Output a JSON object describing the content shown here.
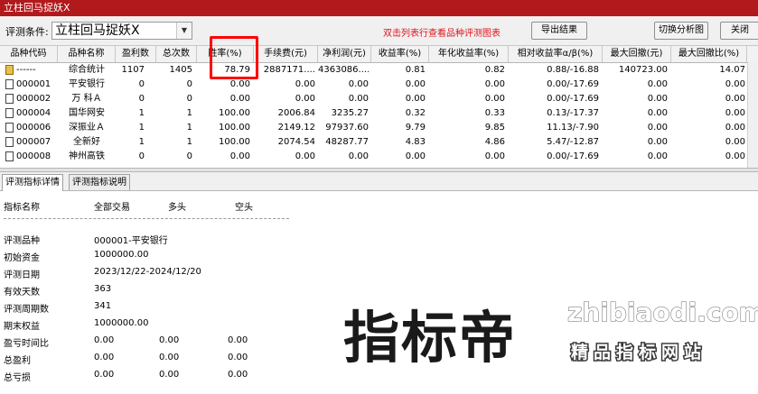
{
  "window": {
    "title": "立柱回马捉妖X"
  },
  "toolbar": {
    "condition_label": "评测条件:",
    "condition_value": "立柱回马捉妖X",
    "hint": "双击列表行查看品种评测图表",
    "export_label": "导出结果",
    "switch_label": "切换分析图",
    "close_label": "关闭"
  },
  "columns": [
    "品种代码",
    "品种名称",
    "盈利数",
    "总次数",
    "胜率(%)",
    "手续费(元)",
    "净利润(元)",
    "收益率(%)",
    "年化收益率(%)",
    "相对收益率α/β(%)",
    "最大回撤(元)",
    "最大回撤比(%)"
  ],
  "rows": [
    {
      "code": "------",
      "name": "综合统计",
      "profit_count": "1107",
      "total": "1405",
      "win_rate": "78.79",
      "fee": "2887171....",
      "net": "4363086....",
      "ret": "0.81",
      "annual": "0.82",
      "alpha": "0.88/-16.88",
      "maxdd": "140723.00",
      "maxdd_pct": "14.07"
    },
    {
      "code": "000001",
      "name": "平安银行",
      "profit_count": "0",
      "total": "0",
      "win_rate": "0.00",
      "fee": "0.00",
      "net": "0.00",
      "ret": "0.00",
      "annual": "0.00",
      "alpha": "0.00/-17.69",
      "maxdd": "0.00",
      "maxdd_pct": "0.00"
    },
    {
      "code": "000002",
      "name": "万 科Ａ",
      "profit_count": "0",
      "total": "0",
      "win_rate": "0.00",
      "fee": "0.00",
      "net": "0.00",
      "ret": "0.00",
      "annual": "0.00",
      "alpha": "0.00/-17.69",
      "maxdd": "0.00",
      "maxdd_pct": "0.00"
    },
    {
      "code": "000004",
      "name": "国华网安",
      "profit_count": "1",
      "total": "1",
      "win_rate": "100.00",
      "fee": "2006.84",
      "net": "3235.27",
      "ret": "0.32",
      "annual": "0.33",
      "alpha": "0.13/-17.37",
      "maxdd": "0.00",
      "maxdd_pct": "0.00"
    },
    {
      "code": "000006",
      "name": "深振业Ａ",
      "profit_count": "1",
      "total": "1",
      "win_rate": "100.00",
      "fee": "2149.12",
      "net": "97937.60",
      "ret": "9.79",
      "annual": "9.85",
      "alpha": "11.13/-7.90",
      "maxdd": "0.00",
      "maxdd_pct": "0.00"
    },
    {
      "code": "000007",
      "name": "全新好",
      "profit_count": "1",
      "total": "1",
      "win_rate": "100.00",
      "fee": "2074.54",
      "net": "48287.77",
      "ret": "4.83",
      "annual": "4.86",
      "alpha": "5.47/-12.87",
      "maxdd": "0.00",
      "maxdd_pct": "0.00"
    },
    {
      "code": "000008",
      "name": "神州高铁",
      "profit_count": "0",
      "total": "0",
      "win_rate": "0.00",
      "fee": "0.00",
      "net": "0.00",
      "ret": "0.00",
      "annual": "0.00",
      "alpha": "0.00/-17.69",
      "maxdd": "0.00",
      "maxdd_pct": "0.00"
    }
  ],
  "tabs": [
    "评测指标详情",
    "评测指标说明"
  ],
  "detail": {
    "headers": [
      "指标名称",
      "全部交易",
      "多头",
      "空头"
    ],
    "items": [
      {
        "label": "评测品种",
        "v1": "000001-平安银行"
      },
      {
        "label": "初始资金",
        "v1": "1000000.00"
      },
      {
        "label": "评测日期",
        "v1": "2023/12/22-2024/12/20"
      },
      {
        "label": "有效天数",
        "v1": "363"
      },
      {
        "label": "评测周期数",
        "v1": "341"
      },
      {
        "label": "期末权益",
        "v1": "1000000.00"
      },
      {
        "label": "盈亏时间比",
        "v1": "0.00",
        "v2": "0.00",
        "v3": "0.00"
      },
      {
        "label": "总盈利",
        "v1": "0.00",
        "v2": "0.00",
        "v3": "0.00"
      },
      {
        "label": "总亏损",
        "v1": "0.00",
        "v2": "0.00",
        "v3": "0.00"
      }
    ]
  },
  "watermark": {
    "brand": "指标帝",
    "url": "zhibiaodi.com",
    "slogan": "精品指标网站"
  }
}
